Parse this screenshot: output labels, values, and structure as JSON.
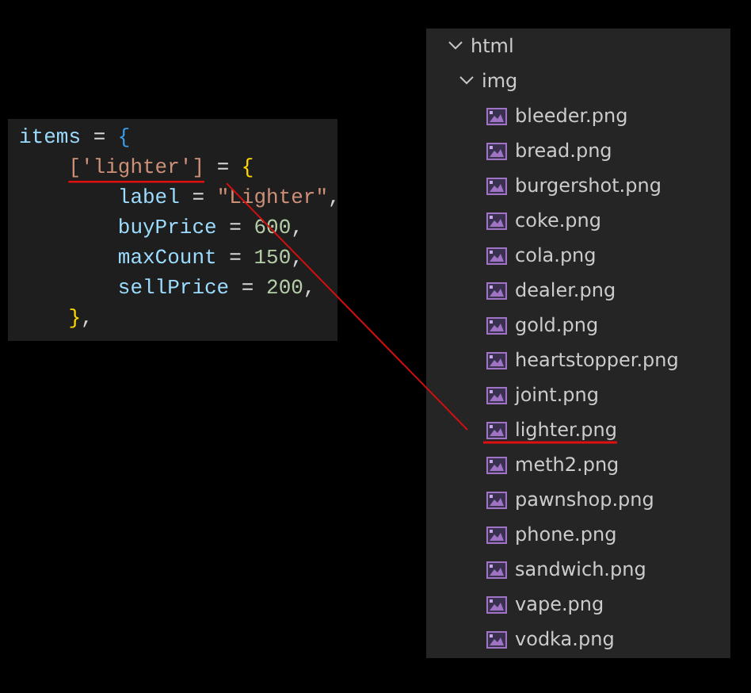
{
  "code_editor": {
    "lines": [
      {
        "tokens": [
          {
            "text": "items",
            "kind": "variable"
          },
          {
            "text": " = ",
            "kind": "operator"
          },
          {
            "text": "{",
            "kind": "brace1"
          }
        ],
        "children": [
          {
            "tokens": [
              {
                "text": "['lighter']",
                "kind": "key",
                "underlined": true
              },
              {
                "text": " = ",
                "kind": "operator"
              },
              {
                "text": "{",
                "kind": "brace2"
              }
            ],
            "children": [
              {
                "tokens": [
                  {
                    "text": "label",
                    "kind": "variable"
                  },
                  {
                    "text": " = ",
                    "kind": "operator"
                  },
                  {
                    "text": "\"Lighter\"",
                    "kind": "string"
                  },
                  {
                    "text": ",",
                    "kind": "operator"
                  }
                ]
              },
              {
                "tokens": [
                  {
                    "text": "buyPrice",
                    "kind": "variable"
                  },
                  {
                    "text": " = ",
                    "kind": "operator"
                  },
                  {
                    "text": "600",
                    "kind": "number"
                  },
                  {
                    "text": ",",
                    "kind": "operator"
                  }
                ]
              },
              {
                "tokens": [
                  {
                    "text": "maxCount",
                    "kind": "variable"
                  },
                  {
                    "text": " = ",
                    "kind": "operator"
                  },
                  {
                    "text": "150",
                    "kind": "number"
                  },
                  {
                    "text": ",",
                    "kind": "operator"
                  }
                ]
              },
              {
                "tokens": [
                  {
                    "text": "sellPrice",
                    "kind": "variable"
                  },
                  {
                    "text": " = ",
                    "kind": "operator"
                  },
                  {
                    "text": "200",
                    "kind": "number"
                  },
                  {
                    "text": ",",
                    "kind": "operator"
                  }
                ]
              }
            ]
          },
          {
            "tokens": [
              {
                "text": "}",
                "kind": "brace2"
              },
              {
                "text": ",",
                "kind": "operator"
              }
            ]
          }
        ]
      }
    ]
  },
  "explorer": {
    "tree": [
      {
        "label": "html",
        "kind": "folder",
        "expanded": true,
        "children": [
          {
            "label": "img",
            "kind": "folder",
            "expanded": true,
            "children": [
              {
                "label": "bleeder.png",
                "kind": "image",
                "underlined": false
              },
              {
                "label": "bread.png",
                "kind": "image",
                "underlined": false
              },
              {
                "label": "burgershot.png",
                "kind": "image",
                "underlined": false
              },
              {
                "label": "coke.png",
                "kind": "image",
                "underlined": false
              },
              {
                "label": "cola.png",
                "kind": "image",
                "underlined": false
              },
              {
                "label": "dealer.png",
                "kind": "image",
                "underlined": false
              },
              {
                "label": "gold.png",
                "kind": "image",
                "underlined": false
              },
              {
                "label": "heartstopper.png",
                "kind": "image",
                "underlined": false
              },
              {
                "label": "joint.png",
                "kind": "image",
                "underlined": false
              },
              {
                "label": "lighter.png",
                "kind": "image",
                "underlined": true
              },
              {
                "label": "meth2.png",
                "kind": "image",
                "underlined": false
              },
              {
                "label": "pawnshop.png",
                "kind": "image",
                "underlined": false
              },
              {
                "label": "phone.png",
                "kind": "image",
                "underlined": false
              },
              {
                "label": "sandwich.png",
                "kind": "image",
                "underlined": false
              },
              {
                "label": "vape.png",
                "kind": "image",
                "underlined": false
              },
              {
                "label": "vodka.png",
                "kind": "image",
                "underlined": false
              }
            ]
          }
        ]
      }
    ]
  }
}
